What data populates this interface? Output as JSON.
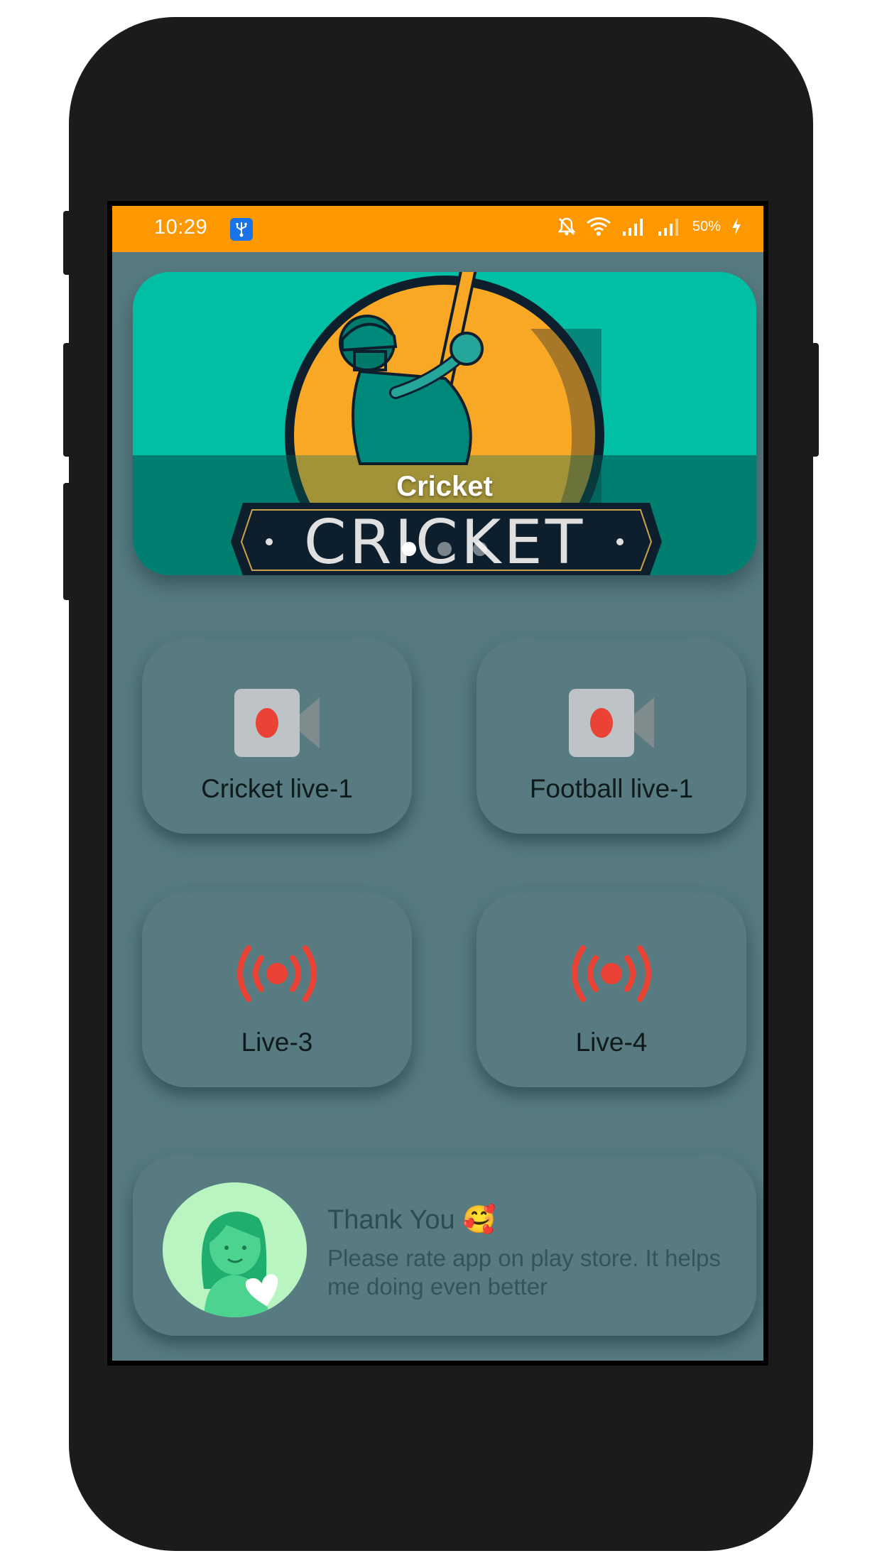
{
  "status_bar": {
    "time": "10:29",
    "battery": "50%",
    "icons": [
      "usb-debug-icon",
      "mute-bell-icon",
      "wifi-icon",
      "signal-icon",
      "signal-icon",
      "charging-bolt-icon"
    ],
    "bg_color": "#fe9800"
  },
  "banner": {
    "caption": "Cricket",
    "artwork_text": "CRICKET",
    "slides_count": 3,
    "active_slide": 1
  },
  "tiles": [
    {
      "label": "Cricket live-1",
      "icon": "video-camera-icon"
    },
    {
      "label": "Football live-1",
      "icon": "video-camera-icon"
    },
    {
      "label": "Live-3",
      "icon": "live-broadcast-icon"
    },
    {
      "label": "Live-4",
      "icon": "live-broadcast-icon"
    }
  ],
  "rate_card": {
    "title": "Thank You",
    "emoji": "🥰",
    "body": "Please rate app on play store. It helps me doing even better",
    "avatar_icon": "woman-heart-icon"
  },
  "colors": {
    "background": "#577b80",
    "accent_red": "#ea4335",
    "banner_teal": "#00bfa5",
    "banner_ball": "#f9a825"
  }
}
